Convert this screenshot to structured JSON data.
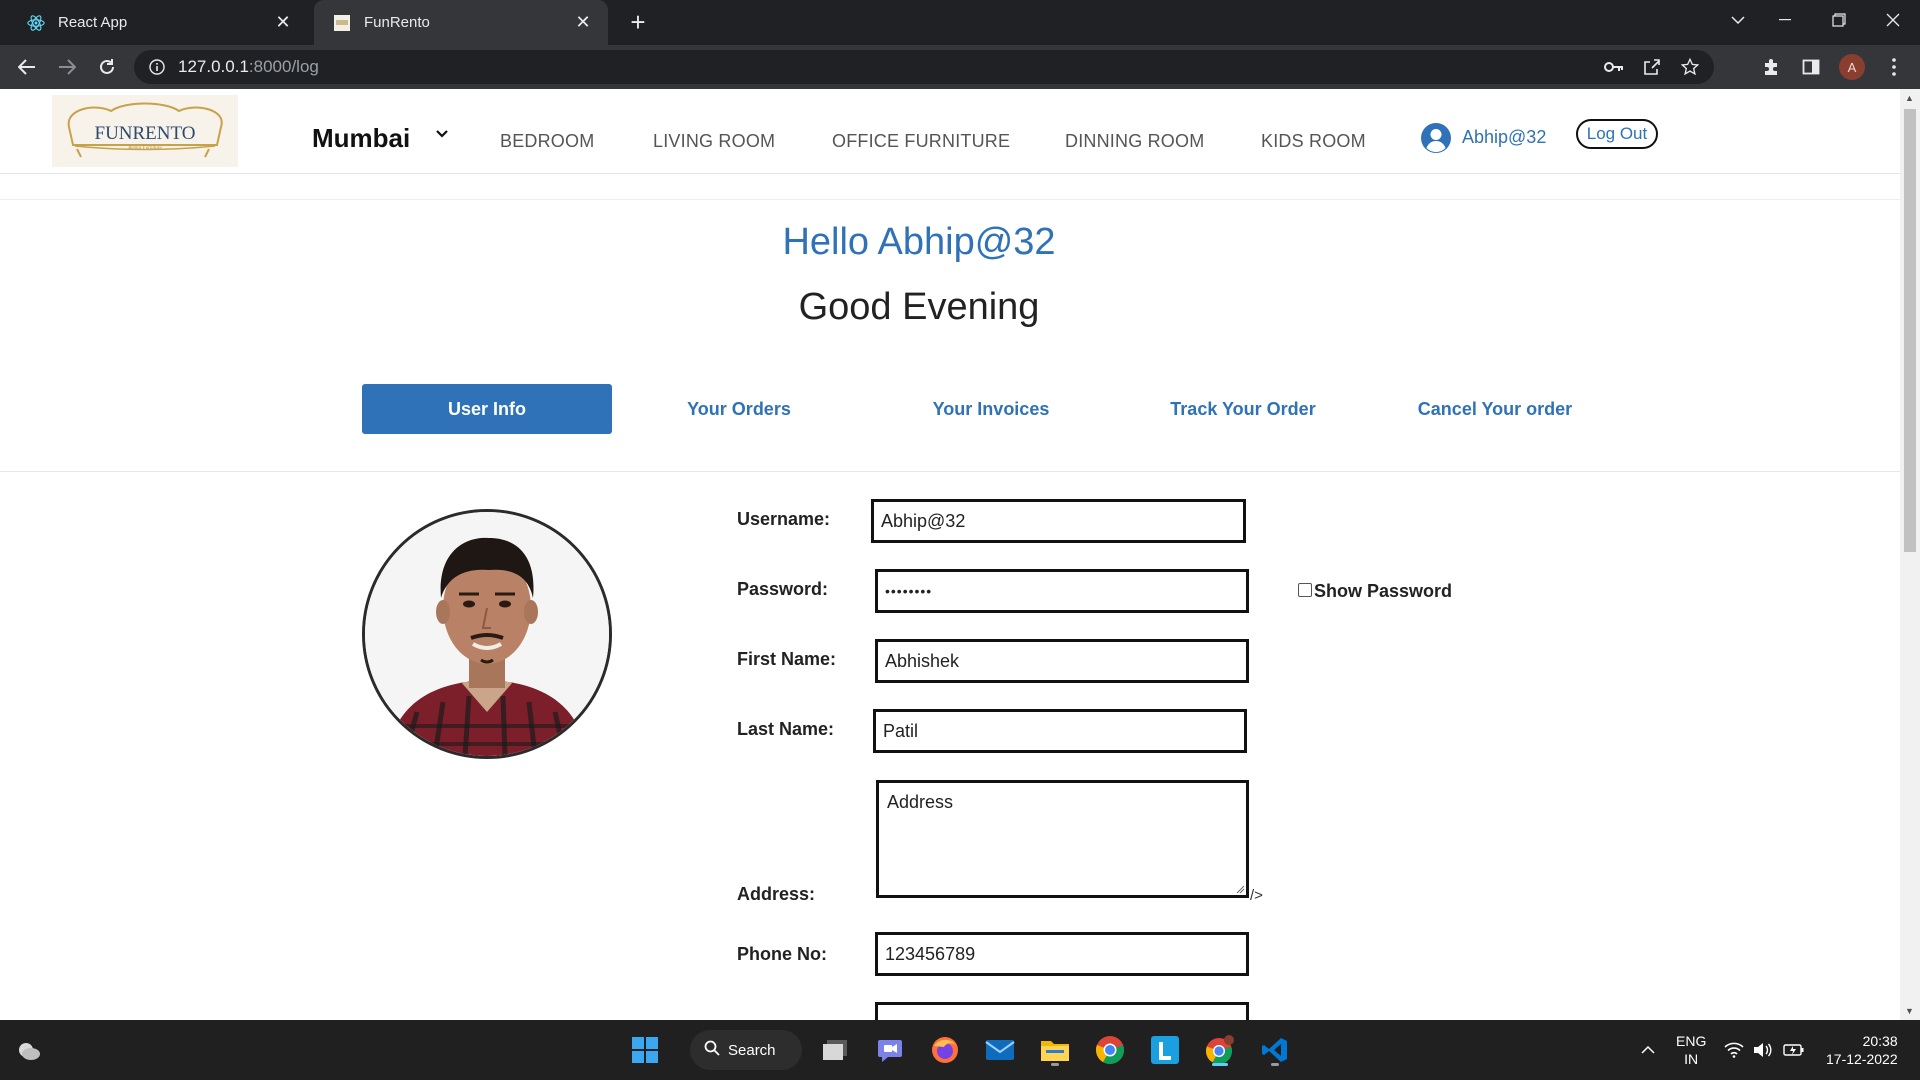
{
  "browser": {
    "tabs": [
      {
        "title": "React App",
        "active": false
      },
      {
        "title": "FunRento",
        "active": true
      }
    ],
    "url_host": "127.0.0.1",
    "url_rest": ":8000/log",
    "profile_initial": "A"
  },
  "site": {
    "logo_text": "FUNRENTO",
    "logo_tagline": "Rental Furniture",
    "city": "Mumbai",
    "nav_links": [
      "BEDROOM",
      "LIVING ROOM",
      "OFFICE FURNITURE",
      "DINNING ROOM",
      "KIDS ROOM"
    ],
    "username": "Abhip@32",
    "logout_label": "Log Out"
  },
  "greeting": {
    "hello": "Hello Abhip@32",
    "time_of_day": "Good Evening"
  },
  "user_tabs": [
    "User Info",
    "Your Orders",
    "Your Invoices",
    "Track Your Order",
    "Cancel Your order"
  ],
  "form": {
    "username_label": "Username:",
    "username_value": "Abhip@32",
    "password_label": "Password:",
    "password_value": "••••••••",
    "show_password_label": "Show Password",
    "first_name_label": "First Name:",
    "first_name_value": "Abhishek",
    "last_name_label": "Last Name:",
    "last_name_value": "Patil",
    "address_label": "Address:",
    "address_placeholder": "Address",
    "stray_text": "/>",
    "phone_label": "Phone No:",
    "phone_value": "123456789"
  },
  "taskbar": {
    "search_label": "Search",
    "lang_top": "ENG",
    "lang_bottom": "IN",
    "time": "20:38",
    "date": "17-12-2022"
  },
  "colors": {
    "accent": "#2f72b7",
    "chrome_dark": "#202124",
    "taskbar": "#202020"
  }
}
